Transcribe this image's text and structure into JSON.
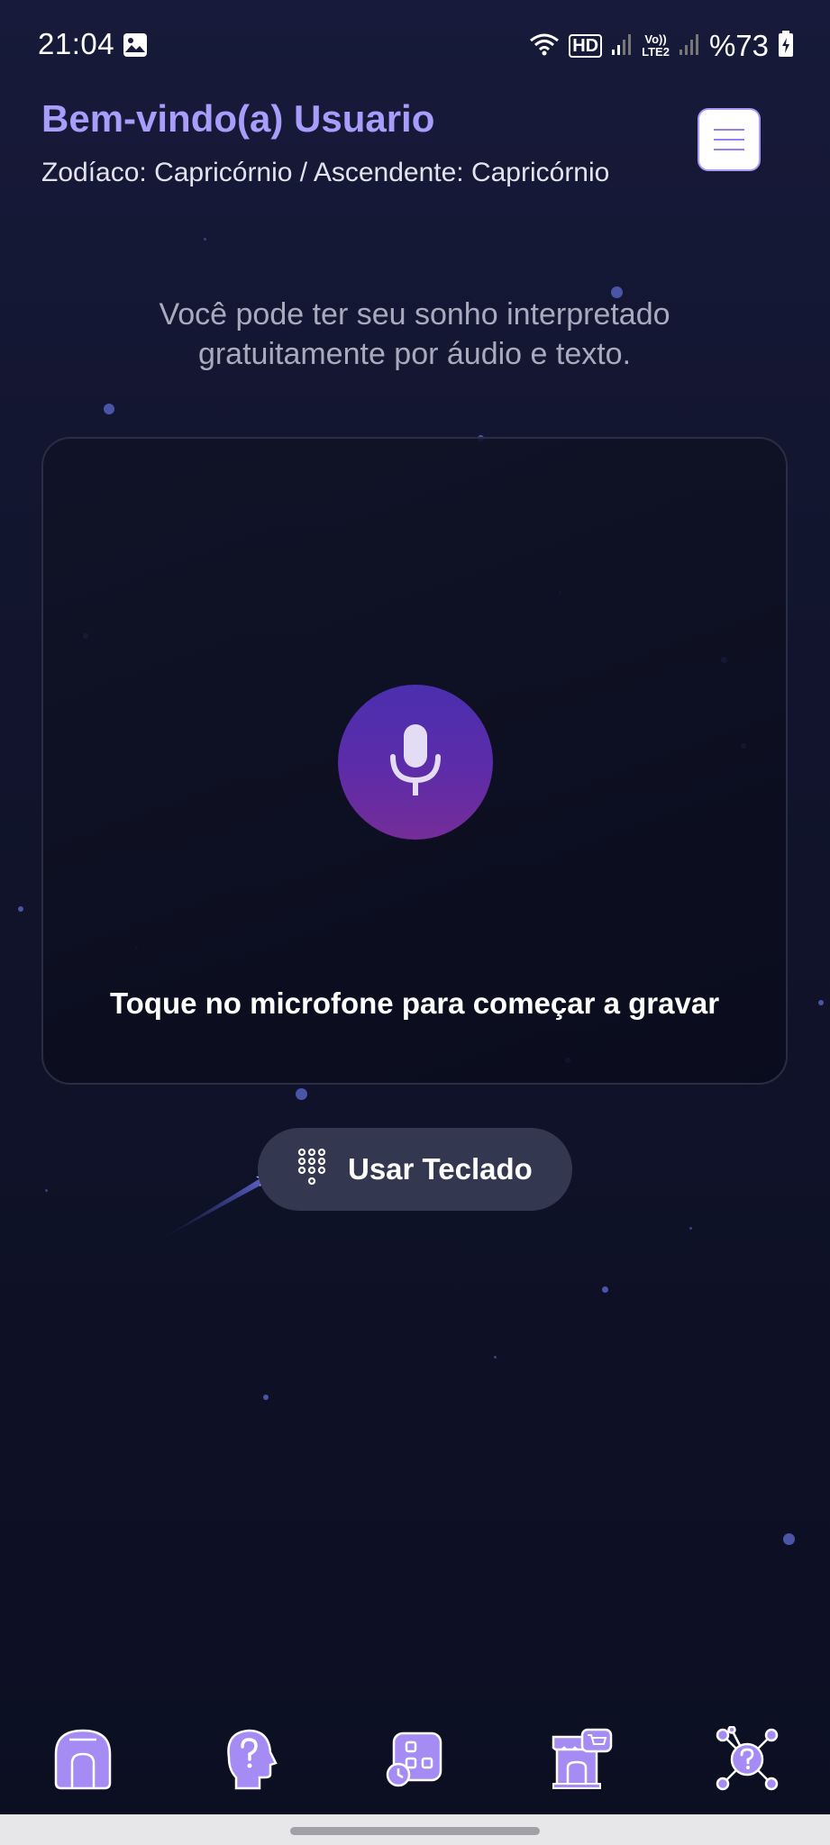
{
  "status_bar": {
    "time": "21:04",
    "battery": "%73",
    "network_hd": "HD",
    "volte": "Vo))\nLTE2",
    "icons": [
      "image-icon",
      "wifi-icon",
      "hd-plus-icon",
      "signal-icon",
      "volte-icon",
      "signal-icon",
      "battery-charging-icon"
    ]
  },
  "header": {
    "welcome": "Bem-vindo(a) Usuario",
    "zodiac": "Zodíaco: Capricórnio / Ascendente: Capricórnio",
    "menu_icon": "menu-icon"
  },
  "intro": {
    "text": "Você pode ter seu sonho interpretado gratuitamente por áudio e texto."
  },
  "record": {
    "mic_icon": "microphone-icon",
    "hint": "Toque no microfone para começar a gravar"
  },
  "keyboard_button": {
    "label": "Usar Teclado",
    "icon": "keypad-icon"
  },
  "bottom_nav": {
    "items": [
      {
        "icon": "home-icon"
      },
      {
        "icon": "head-question-icon"
      },
      {
        "icon": "history-grid-icon"
      },
      {
        "icon": "store-icon"
      },
      {
        "icon": "network-question-icon"
      }
    ]
  },
  "colors": {
    "accent": "#a89dfb",
    "mic_gradient_top": "#4b2fae",
    "mic_gradient_bottom": "#742d98",
    "nav_icon": "#a58cf5",
    "background": "#12152e"
  }
}
